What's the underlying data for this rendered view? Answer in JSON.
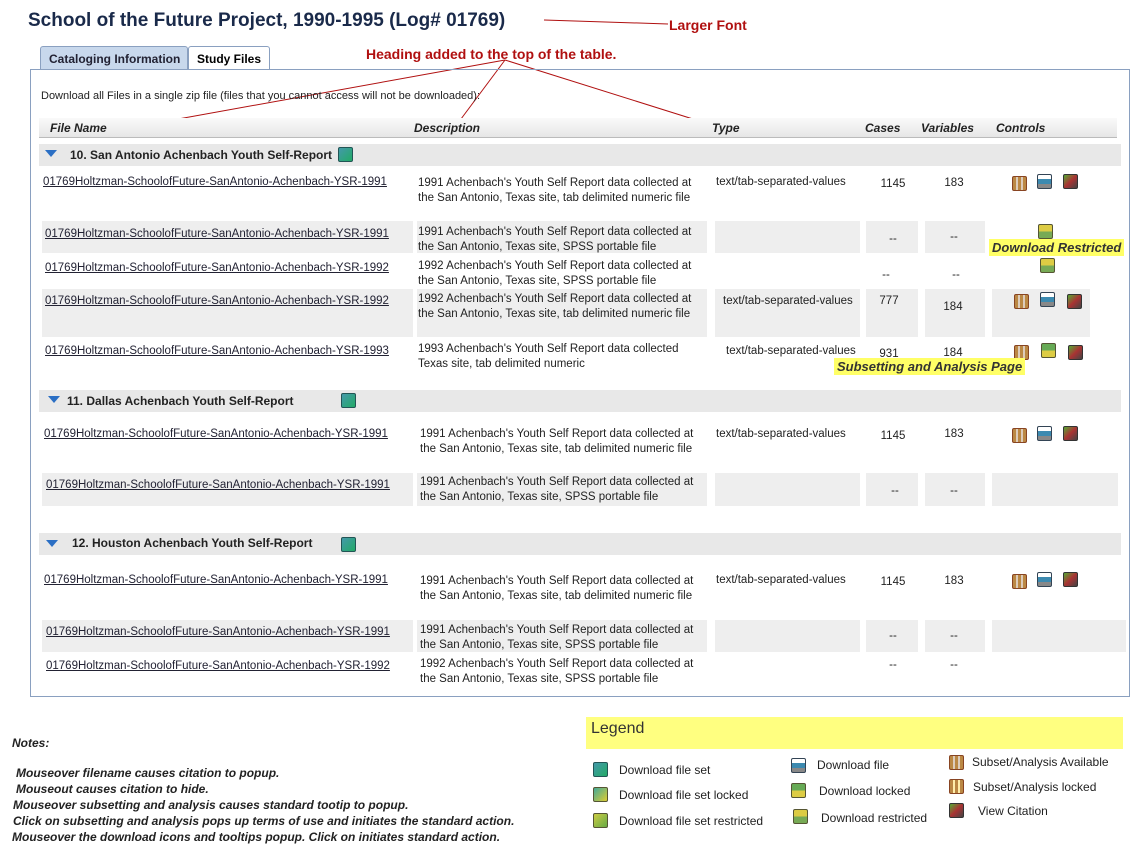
{
  "title": "School of the Future Project, 1990-1995 (Log# 01769)",
  "annotations": {
    "larger_font": "Larger Font",
    "heading_added": "Heading added to the top of the table.",
    "download_restricted": "Download Restricted",
    "subsetting_page": "Subsetting and Analysis Page"
  },
  "tabs": [
    {
      "label": "Cataloging Information",
      "active": false
    },
    {
      "label": "Study Files",
      "active": true
    }
  ],
  "download_all": "Download all Files in a single zip file (files that you cannot access will not be downloaded):",
  "columns": {
    "file_name": "File Name",
    "description": "Description",
    "type": "Type",
    "cases": "Cases",
    "variables": "Variables",
    "controls": "Controls"
  },
  "groups": [
    {
      "label": "10. San Antonio Achenbach Youth Self-Report",
      "rows": [
        {
          "file": "01769Holtzman-SchoolofFuture-SanAntonio-Achenbach-YSR-1991",
          "desc": "1991 Achenbach's Youth Self Report data collected at the San Antonio, Texas site, tab delimited numeric file",
          "type": "text/tab-separated-values",
          "cases": "1145",
          "vars": "183"
        },
        {
          "file": "01769Holtzman-SchoolofFuture-SanAntonio-Achenbach-YSR-1991",
          "desc": "1991 Achenbach's Youth Self Report data collected at the San Antonio, Texas site, SPSS portable file",
          "type": "",
          "cases": "--",
          "vars": "--"
        },
        {
          "file": "01769Holtzman-SchoolofFuture-SanAntonio-Achenbach-YSR-1992",
          "desc": "1992 Achenbach's Youth Self Report data collected at the San Antonio, Texas site, SPSS portable file",
          "type": "",
          "cases": "--",
          "vars": "--"
        },
        {
          "file": "01769Holtzman-SchoolofFuture-SanAntonio-Achenbach-YSR-1992",
          "desc": "1992 Achenbach's Youth Self Report data collected at the San Antonio, Texas site, tab delimited numeric file",
          "type": "text/tab-separated-values",
          "cases": "777",
          "vars": "184"
        },
        {
          "file": "01769Holtzman-SchoolofFuture-SanAntonio-Achenbach-YSR-1993",
          "desc": "1993 Achenbach's Youth Self Report data collected Texas site, tab delimited numeric",
          "type": "text/tab-separated-values",
          "cases": "931",
          "vars": "184"
        }
      ]
    },
    {
      "label": "11. Dallas Achenbach Youth Self-Report",
      "rows": [
        {
          "file": "01769Holtzman-SchoolofFuture-SanAntonio-Achenbach-YSR-1991",
          "desc": "1991 Achenbach's Youth Self Report data collected at the San Antonio, Texas site, tab delimited numeric file",
          "type": "text/tab-separated-values",
          "cases": "1145",
          "vars": "183"
        },
        {
          "file": "01769Holtzman-SchoolofFuture-SanAntonio-Achenbach-YSR-1991",
          "desc": "1991 Achenbach's Youth Self Report data collected at the San Antonio, Texas site, SPSS portable file",
          "type": "",
          "cases": "--",
          "vars": "--"
        }
      ]
    },
    {
      "label": "12. Houston Achenbach Youth Self-Report",
      "rows": [
        {
          "file": "01769Holtzman-SchoolofFuture-SanAntonio-Achenbach-YSR-1991",
          "desc": "1991 Achenbach's Youth Self Report data collected at the San Antonio, Texas site, tab delimited numeric file",
          "type": "text/tab-separated-values",
          "cases": "1145",
          "vars": "183"
        },
        {
          "file": "01769Holtzman-SchoolofFuture-SanAntonio-Achenbach-YSR-1991",
          "desc": "1991 Achenbach's Youth Self Report data collected at the San Antonio, Texas site, SPSS portable file",
          "type": "",
          "cases": "--",
          "vars": "--"
        },
        {
          "file": "01769Holtzman-SchoolofFuture-SanAntonio-Achenbach-YSR-1992",
          "desc": "1992 Achenbach's Youth Self Report data collected at the San Antonio, Texas site, SPSS portable file",
          "type": "",
          "cases": "--",
          "vars": "--"
        }
      ]
    }
  ],
  "notes": {
    "heading": "Notes:",
    "lines": [
      "Mouseover filename causes citation to popup.",
      "Mouseout causes citation to hide.",
      "Mouseover subsetting and analysis causes standard tootip to popup.",
      "Click on subsetting and analysis pops up terms of use and initiates the standard action.",
      "Mouseover the download icons and tooltips popup. Click on initiates standard action."
    ]
  },
  "legend": {
    "title": "Legend",
    "items": [
      {
        "icon": "download-file-set-icon",
        "label": "Download file set"
      },
      {
        "icon": "download-file-set-locked-icon",
        "label": "Download file set locked"
      },
      {
        "icon": "download-file-set-restricted-icon",
        "label": "Download file set restricted"
      },
      {
        "icon": "download-file-icon",
        "label": "Download file"
      },
      {
        "icon": "download-locked-icon",
        "label": "Download locked"
      },
      {
        "icon": "download-restricted-icon",
        "label": "Download restricted"
      },
      {
        "icon": "subset-analysis-available-icon",
        "label": "Subset/Analysis Available"
      },
      {
        "icon": "subset-analysis-locked-icon",
        "label": "Subset/Analysis locked"
      },
      {
        "icon": "view-citation-icon",
        "label": "View Citation"
      }
    ]
  }
}
